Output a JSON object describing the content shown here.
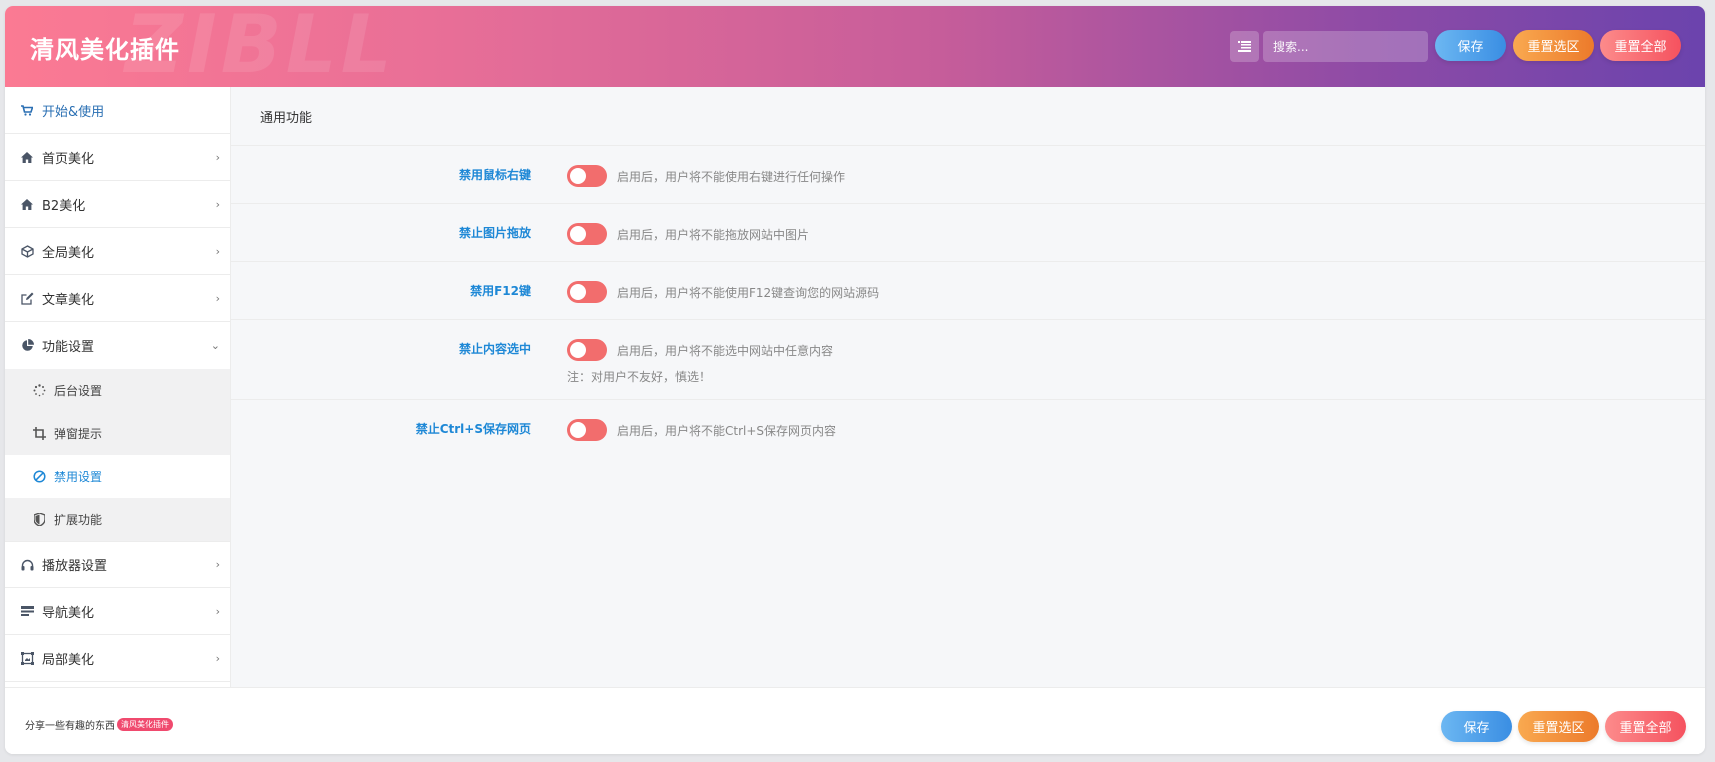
{
  "header": {
    "title": "清风美化插件",
    "watermark": "ZIBLL",
    "search_placeholder": "搜索...",
    "save_label": "保存",
    "reset_section_label": "重置选区",
    "reset_all_label": "重置全部"
  },
  "sidebar": {
    "items": [
      {
        "label": "开始&使用",
        "icon": "cart-icon"
      },
      {
        "label": "首页美化",
        "icon": "home-icon"
      },
      {
        "label": "B2美化",
        "icon": "home-icon"
      },
      {
        "label": "全局美化",
        "icon": "cube-icon"
      },
      {
        "label": "文章美化",
        "icon": "edit-icon"
      },
      {
        "label": "功能设置",
        "icon": "pie-chart-icon"
      },
      {
        "label": "播放器设置",
        "icon": "headphones-icon"
      },
      {
        "label": "导航美化",
        "icon": "nav-bars-icon"
      },
      {
        "label": "局部美化",
        "icon": "frame-icon"
      }
    ],
    "sub_items": [
      {
        "label": "后台设置",
        "icon": "spinner-icon"
      },
      {
        "label": "弹窗提示",
        "icon": "crop-icon"
      },
      {
        "label": "禁用设置",
        "icon": "ban-icon"
      },
      {
        "label": "扩展功能",
        "icon": "shield-icon"
      }
    ]
  },
  "main": {
    "section_title": "通用功能",
    "rows": [
      {
        "label": "禁用鼠标右键",
        "desc": "启用后，用户将不能使用右键进行任何操作",
        "enabled": true
      },
      {
        "label": "禁止图片拖放",
        "desc": "启用后，用户将不能拖放网站中图片",
        "enabled": true
      },
      {
        "label": "禁用F12键",
        "desc": "启用后，用户将不能使用F12键查询您的网站源码",
        "enabled": true
      },
      {
        "label": "禁止内容选中",
        "desc": "启用后，用户将不能选中网站中任意内容",
        "note": "注：对用户不友好，慎选！",
        "enabled": true
      },
      {
        "label": "禁止Ctrl+S保存网页",
        "desc": "启用后，用户将不能Ctrl+S保存网页内容",
        "enabled": true
      }
    ]
  },
  "footer": {
    "credit_text": "分享一些有趣的东西",
    "badge_text": "清风美化插件",
    "save_label": "保存",
    "reset_section_label": "重置选区",
    "reset_all_label": "重置全部"
  },
  "colors": {
    "accent_blue": "#1e88d6",
    "toggle_on": "#f26d6d",
    "header_start": "#fb7a93",
    "header_end": "#6b43ad"
  }
}
